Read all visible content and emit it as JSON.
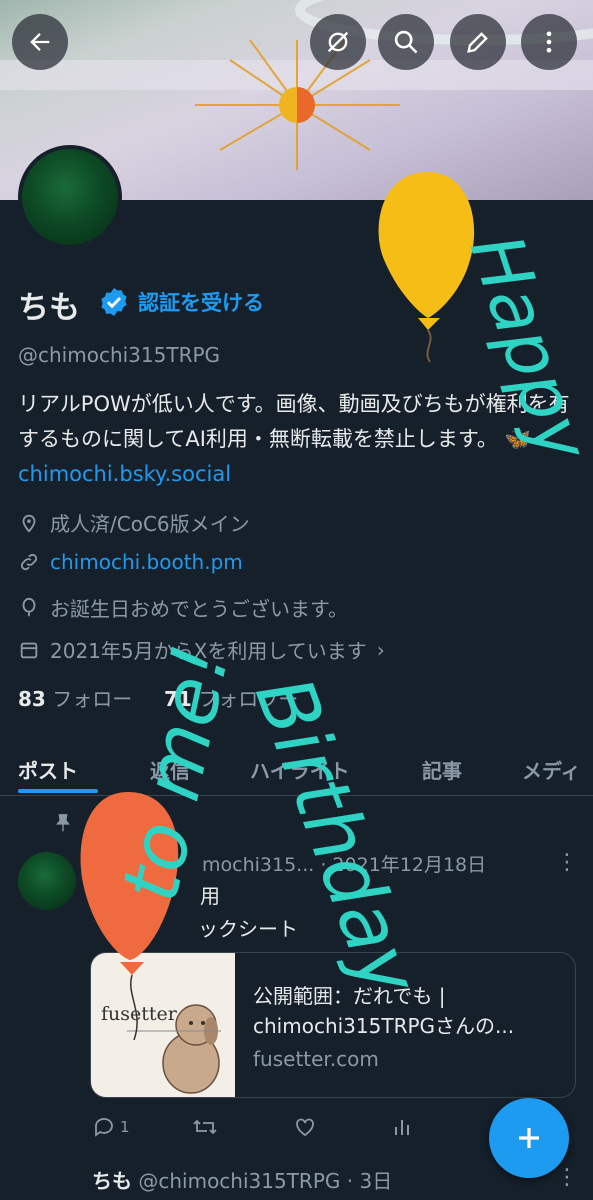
{
  "profile": {
    "name": "ちも",
    "verify_label": "認証を受ける",
    "handle": "@chimochi315TRPG",
    "bio_text": "リアルPOWが低い人です。画像、動画及びちもが権利を有するものに関してAI利用・無断転載を禁止します。",
    "bio_link": "🦋chimochi.bsky.social",
    "location": "成人済/CoC6版メイン",
    "website": "chimochi.booth.pm",
    "birthday": "お誕生日おめでとうございます。",
    "joined": "2021年5月からXを利用しています",
    "following_count": "83",
    "following_label": "フォロー",
    "followers_count": "71",
    "followers_label": "フォロワー"
  },
  "tabs": [
    {
      "label": "ポスト"
    },
    {
      "label": "返信"
    },
    {
      "label": "ハイライト"
    },
    {
      "label": "記事"
    },
    {
      "label": "メディ"
    }
  ],
  "pinned_post": {
    "author_handle": "mochi315...",
    "date": "· 2021年12月18日",
    "line1": "用",
    "line2": "ックシート",
    "card_title": "公開範囲：だれでも | chimochi315TRPGさんの...",
    "card_domain": "fusetter.com",
    "card_image_text": "fusetter",
    "reply_count": "1"
  },
  "second_post": {
    "author_name": "ちも",
    "author_handle": "@chimochi315TRPG",
    "time": "· 3日"
  },
  "overlay": {
    "line1": "Happy",
    "line2": "Birthday",
    "line3": "to me!"
  },
  "colors": {
    "background": "#15202b",
    "accent": "#1d9bf0",
    "overlay_text": "#2fd3c4",
    "balloon_yellow": "#f6bd16",
    "balloon_orange": "#ef6a3e"
  },
  "icons": [
    "back-arrow-icon",
    "sync-off-icon",
    "search-icon",
    "edit-icon",
    "more-icon",
    "verified-badge-icon",
    "location-icon",
    "link-icon",
    "balloon-icon",
    "calendar-icon",
    "pin-icon",
    "reply-icon",
    "retweet-icon",
    "like-icon",
    "analytics-icon",
    "compose-plus-icon"
  ]
}
